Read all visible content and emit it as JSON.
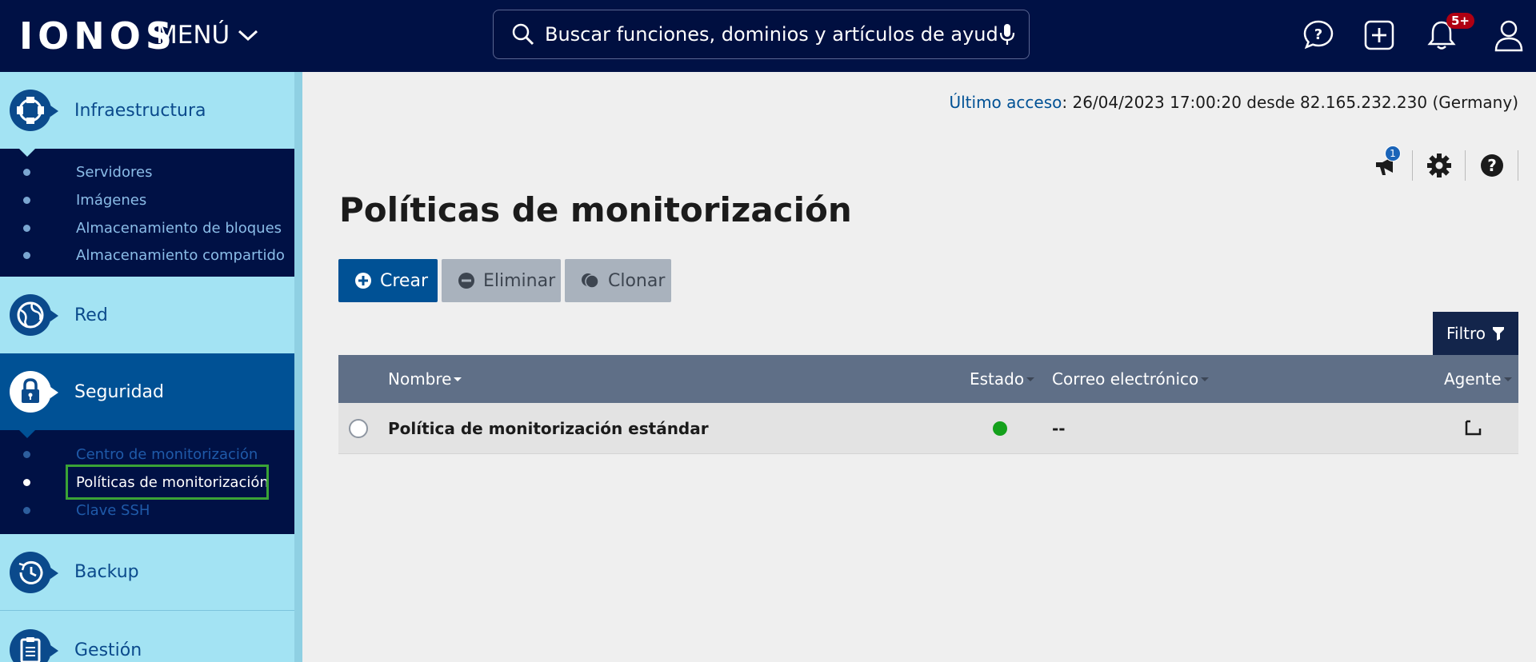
{
  "header": {
    "logo": "IONOS",
    "menu_label": "MENÚ",
    "search_placeholder": "Buscar funciones, dominios y artículos de ayuda",
    "notifications_badge": "5+"
  },
  "sidebar": {
    "categories": [
      {
        "label": "Infraestructura",
        "icon": "infrastructure-icon"
      },
      {
        "label": "Red",
        "icon": "network-globe-icon"
      },
      {
        "label": "Seguridad",
        "icon": "lock-icon",
        "active": true
      },
      {
        "label": "Backup",
        "icon": "backup-clock-icon"
      },
      {
        "label": "Gestión",
        "icon": "clipboard-icon"
      }
    ],
    "infra_items": [
      "Servidores",
      "Imágenes",
      "Almacenamiento de bloques",
      "Almacenamiento compartido"
    ],
    "security_items": [
      "Centro de monitorización",
      "Políticas de monitorización",
      "Clave SSH"
    ]
  },
  "main": {
    "last_access_label": "Último acceso",
    "last_access_value": ": 26/04/2023 17:00:20 desde 82.165.232.230 (Germany)",
    "announcements_badge": "1",
    "page_title": "Políticas de monitorización",
    "buttons": {
      "create": "Crear",
      "delete": "Eliminar",
      "clone": "Clonar"
    },
    "filter_label": "Filtro",
    "table": {
      "columns": [
        "Nombre",
        "Estado",
        "Correo electrónico",
        "Agente"
      ],
      "rows": [
        {
          "name": "Política de monitorización estándar",
          "status": "active",
          "email": "--"
        }
      ]
    }
  },
  "colors": {
    "topbar": "#001145",
    "sidebar": "#a3e3f3",
    "primary": "#005195",
    "status_ok": "#14a11c"
  }
}
